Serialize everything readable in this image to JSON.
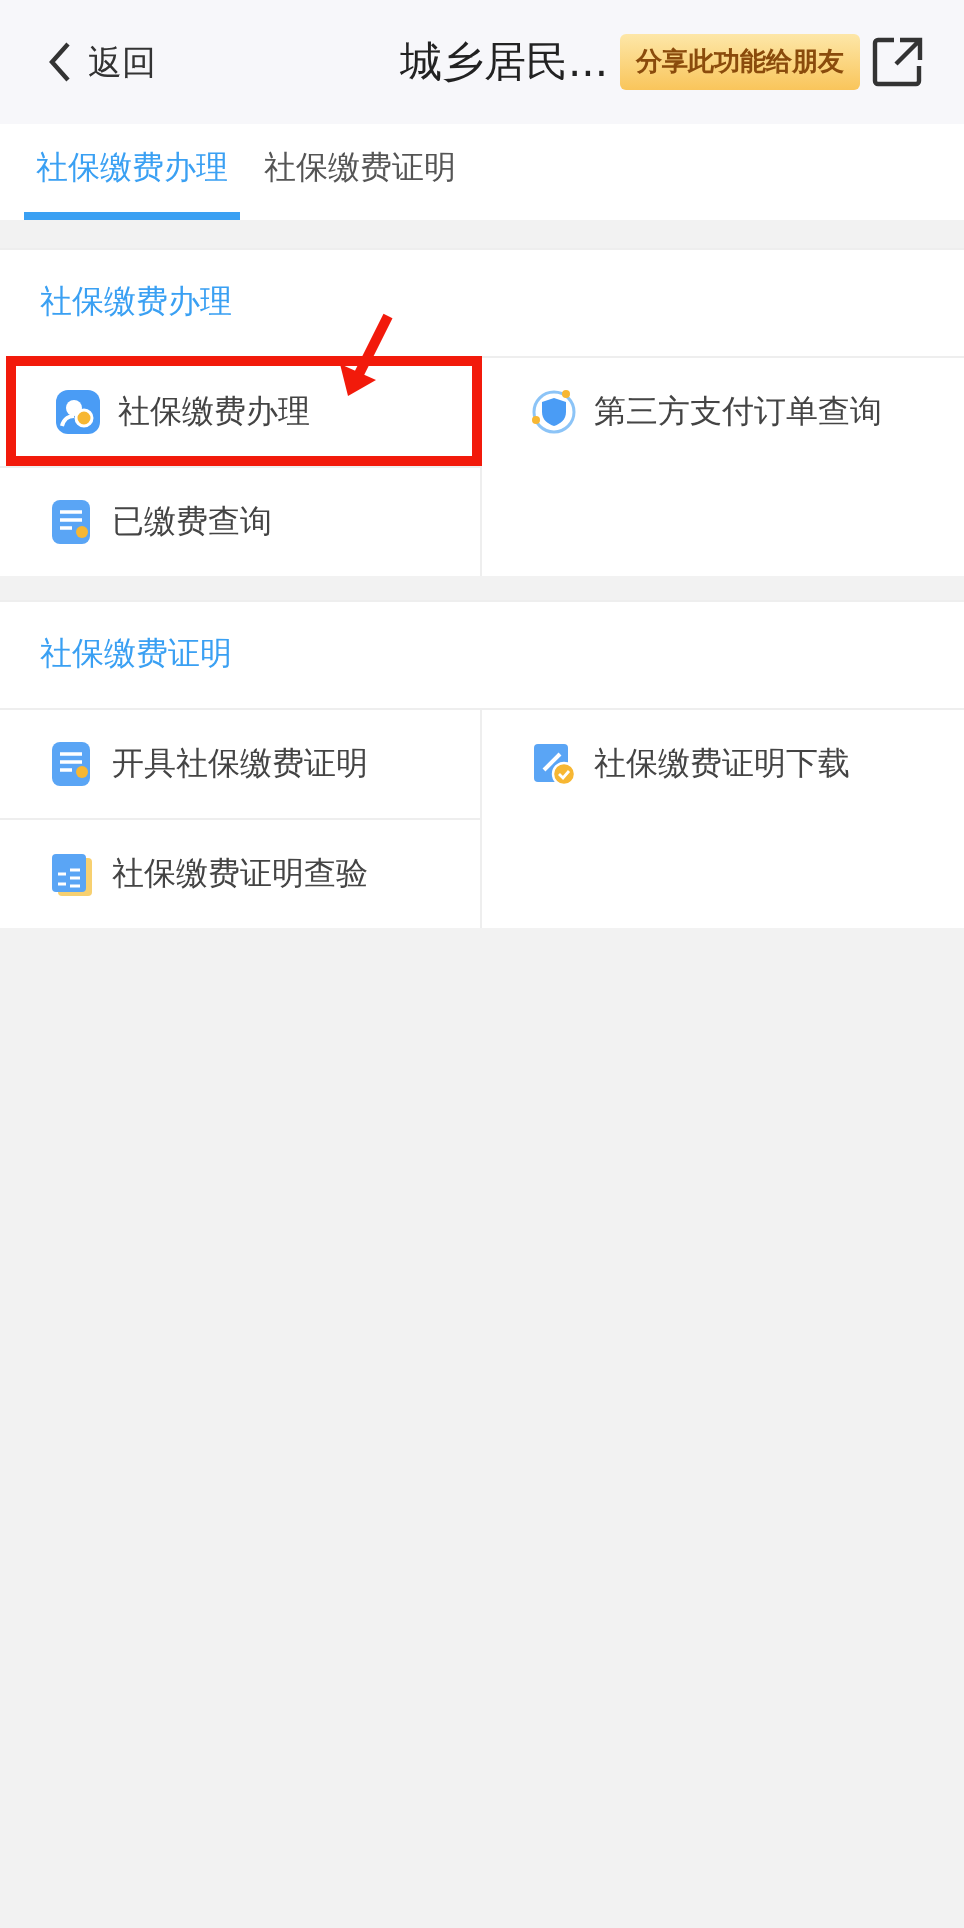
{
  "header": {
    "back": "返回",
    "title": "城乡居民...",
    "share_tip": "分享此功能给朋友"
  },
  "tabs": [
    {
      "label": "社保缴费办理",
      "selected": true
    },
    {
      "label": "社保缴费证明",
      "selected": false
    }
  ],
  "sections": [
    {
      "title": "社保缴费办理",
      "items": [
        {
          "label": "社保缴费办理",
          "highlighted": true
        },
        {
          "label": "第三方支付订单查询",
          "highlighted": false
        },
        {
          "label": "已缴费查询",
          "highlighted": false
        }
      ]
    },
    {
      "title": "社保缴费证明",
      "items": [
        {
          "label": "开具社保缴费证明",
          "highlighted": false
        },
        {
          "label": "社保缴费证明下载",
          "highlighted": false
        },
        {
          "label": "社保缴费证明查验",
          "highlighted": false
        }
      ]
    }
  ]
}
